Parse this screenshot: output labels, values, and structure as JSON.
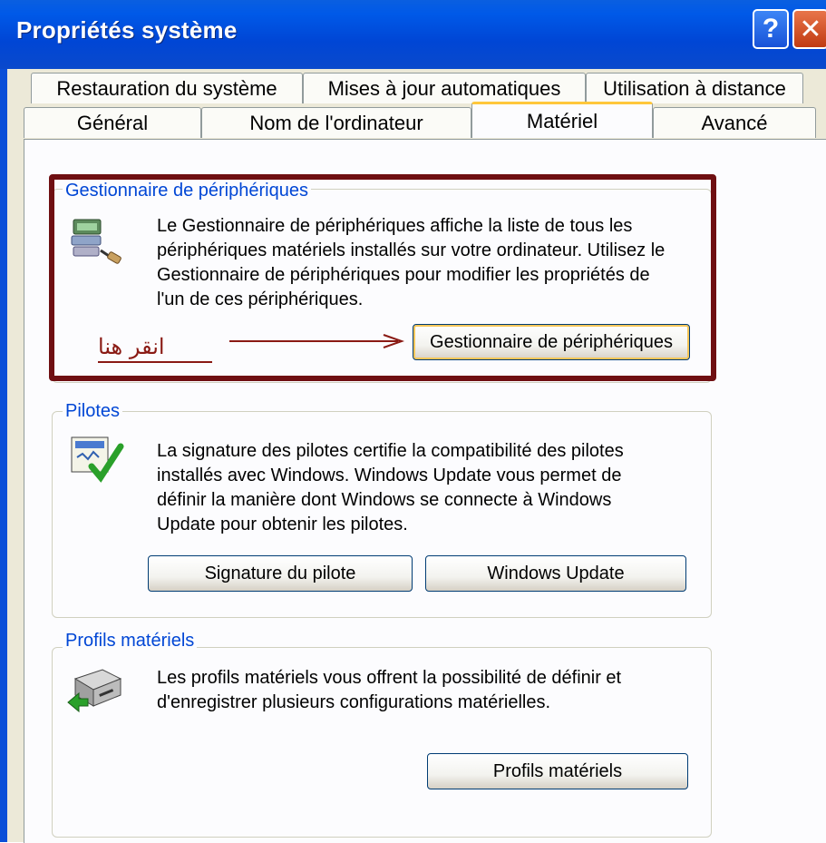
{
  "window": {
    "title": "Propriétés système"
  },
  "tabs_row1": [
    "Restauration du système",
    "Mises à jour automatiques",
    "Utilisation à distance"
  ],
  "tabs_row2": [
    "Général",
    "Nom de l'ordinateur",
    "Matériel",
    "Avancé"
  ],
  "active_tab": "Matériel",
  "device_manager": {
    "title": "Gestionnaire de périphériques",
    "description_lines": [
      "Le Gestionnaire de périphériques affiche la liste de tous les",
      "périphériques matériels installés sur votre ordinateur. Utilisez le",
      "Gestionnaire de périphériques pour modifier les propriétés de",
      "l'un de ces périphériques."
    ],
    "button": "Gestionnaire de périphériques",
    "annotation": "انقر هنا"
  },
  "drivers": {
    "title": "Pilotes",
    "description_lines": [
      "La signature des pilotes certifie la compatibilité des pilotes",
      "installés avec Windows. Windows Update vous permet de",
      "définir la manière dont Windows se connecte à Windows",
      "Update pour obtenir les pilotes."
    ],
    "button_signature": "Signature du pilote",
    "button_update": "Windows Update"
  },
  "hardware_profiles": {
    "title": "Profils matériels",
    "description_lines": [
      "Les profils matériels vous offrent la possibilité de définir et",
      "d'enregistrer plusieurs configurations matérielles."
    ],
    "button": "Profils matériels"
  },
  "colors": {
    "accent": "#0046d5",
    "highlight_border": "#6f0f12",
    "annotation": "#8a1a14"
  }
}
